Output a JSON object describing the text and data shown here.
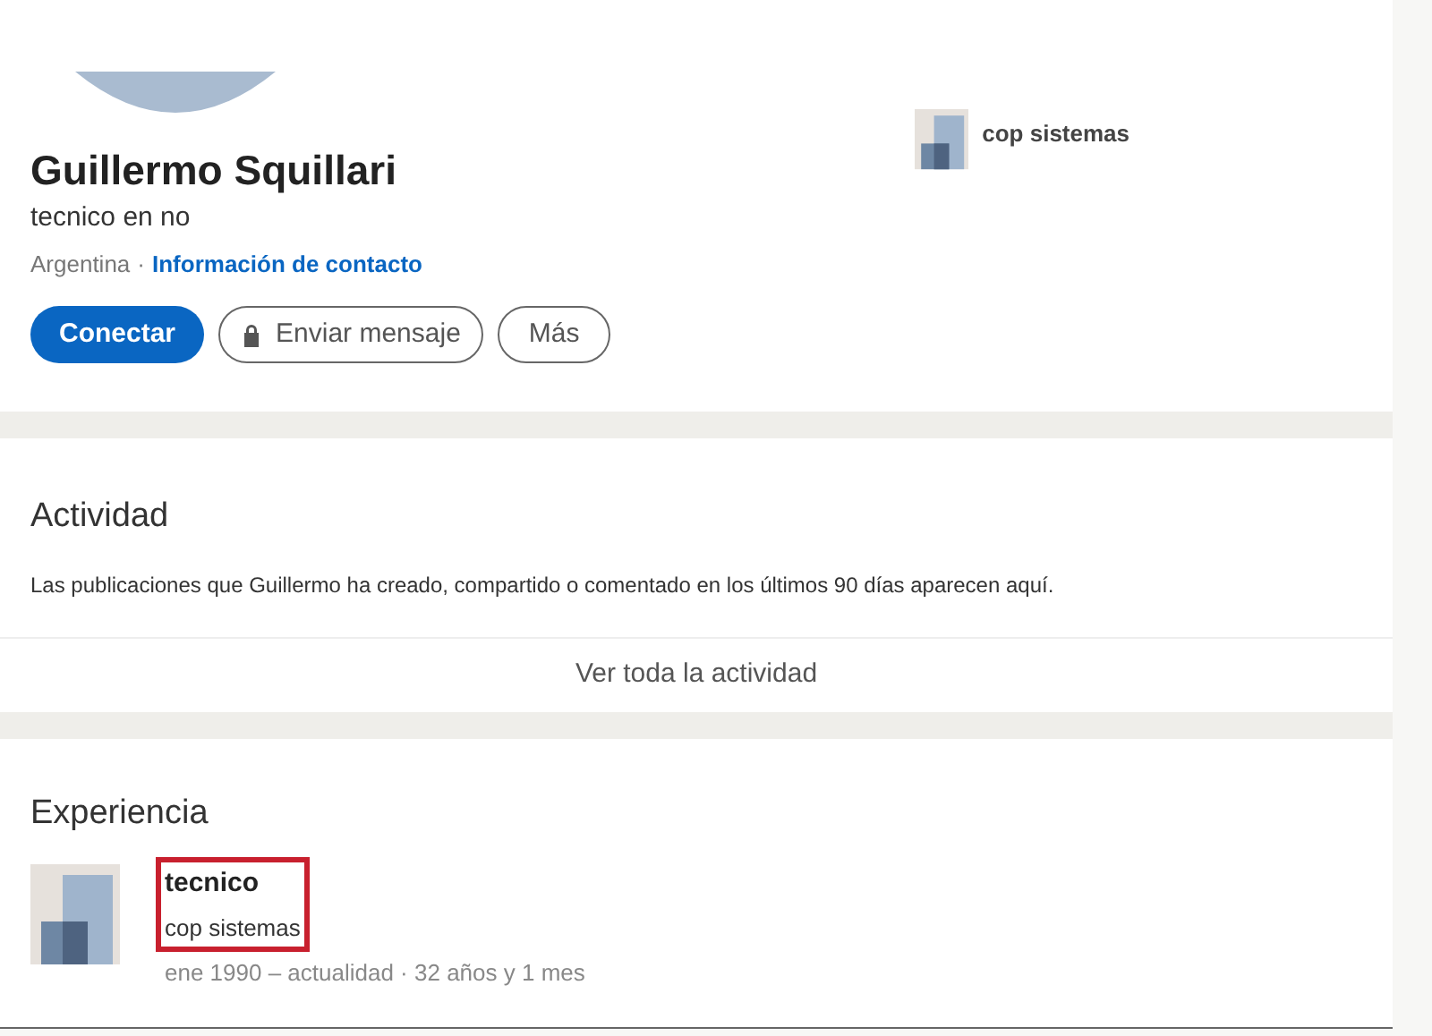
{
  "profile": {
    "name": "Guillermo Squillari",
    "headline": "tecnico en no",
    "location": "Argentina",
    "location_separator": "·",
    "contact_link": "Información de contacto",
    "current_company": "cop sistemas"
  },
  "actions": [
    {
      "kind": "primary",
      "label": "Conectar"
    },
    {
      "kind": "locked",
      "label": "Enviar mensaje"
    },
    {
      "kind": "outline",
      "label": "Más"
    }
  ],
  "activity": {
    "title": "Actividad",
    "description": "Las publicaciones que Guillermo ha creado, compartido o comentado en los últimos 90 días aparecen aquí.",
    "link": "Ver toda la actividad"
  },
  "experience": {
    "title": "Experiencia",
    "items": [
      {
        "title": "tecnico",
        "company": "cop sistemas",
        "dates": "ene 1990 – actualidad · 32 años y 1 mes",
        "highlighted": true
      }
    ]
  }
}
